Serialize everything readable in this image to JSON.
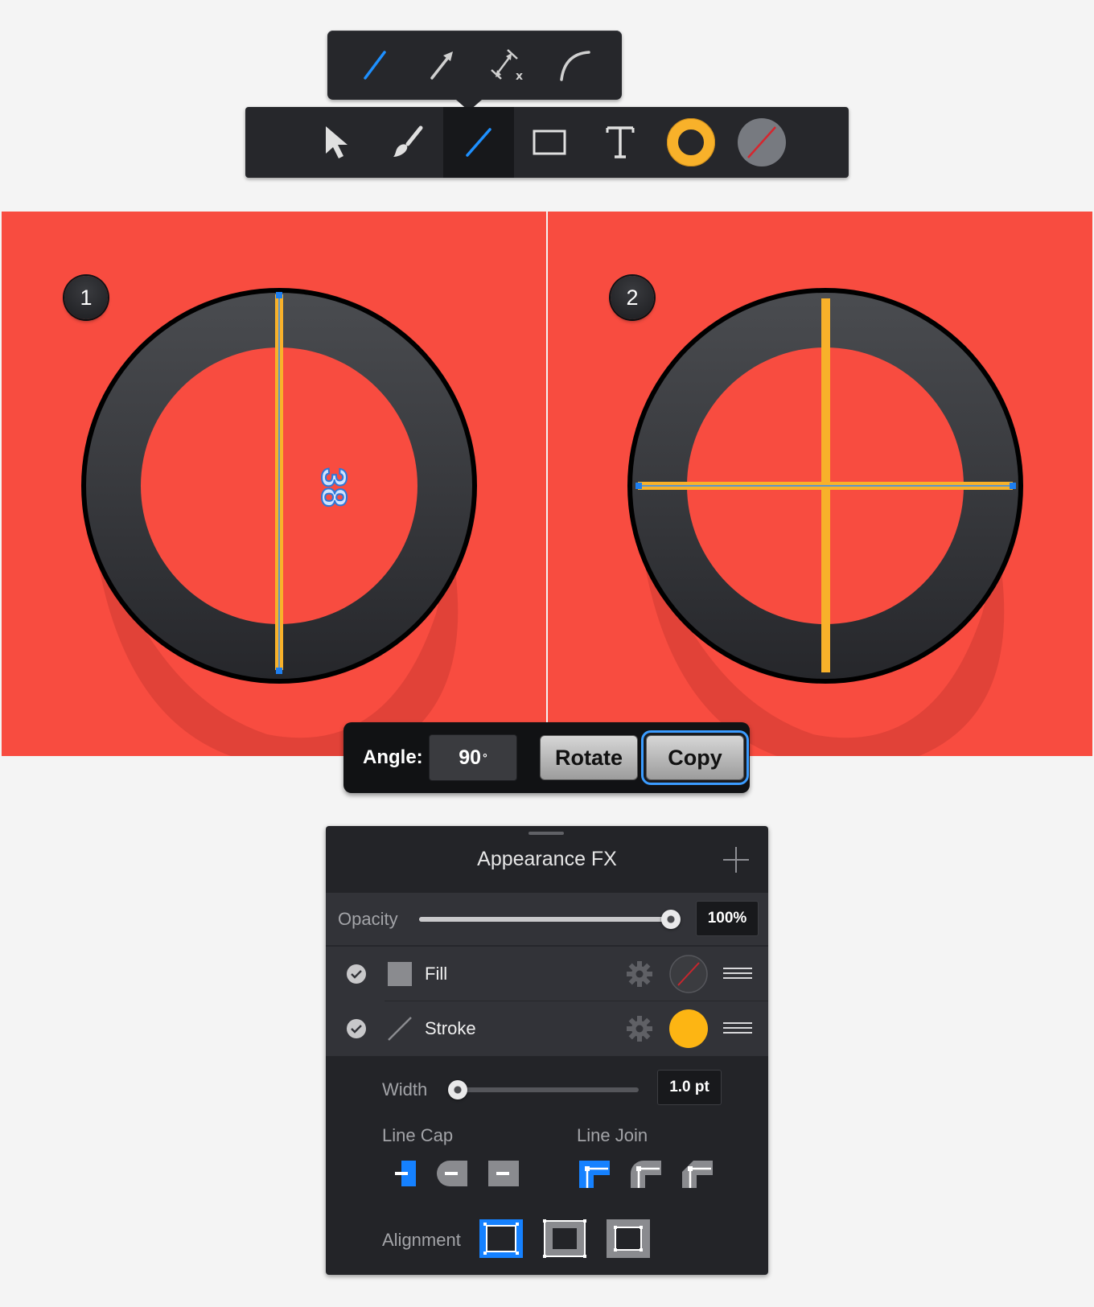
{
  "line_submenu": {
    "tools": [
      {
        "name": "line-tool",
        "color": "#1e90ff"
      },
      {
        "name": "arrow-tool",
        "color": "#cfcfcf"
      },
      {
        "name": "dimension-tool",
        "color": "#cfcfcf"
      },
      {
        "name": "arc-tool",
        "color": "#cfcfcf"
      }
    ]
  },
  "toolbar": {
    "tools": [
      "select-tool",
      "brush-tool",
      "line-tool",
      "rectangle-tool",
      "text-tool",
      "stroke-color-swatch",
      "fill-color-swatch"
    ],
    "active": "line-tool",
    "stroke_color": "#f8b12a",
    "fill_color": "none"
  },
  "canvas": {
    "background": "#f84c40",
    "steps": [
      {
        "badge": "1",
        "measure_label": "38"
      },
      {
        "badge": "2"
      }
    ]
  },
  "angle_dialog": {
    "label": "Angle:",
    "value": "90",
    "unit": "°",
    "rotate_label": "Rotate",
    "copy_label": "Copy"
  },
  "appearance": {
    "title": "Appearance FX",
    "opacity_label": "Opacity",
    "opacity_value": "100%",
    "opacity_level": 1.0,
    "rows": [
      {
        "label": "Fill",
        "enabled": true,
        "swatch": "none"
      },
      {
        "label": "Stroke",
        "enabled": true,
        "swatch": "#fdb513"
      }
    ],
    "width_label": "Width",
    "width_value": "1.0 pt",
    "width_level": 0.04,
    "line_cap_label": "Line Cap",
    "line_join_label": "Line Join",
    "alignment_label": "Alignment",
    "accent": "#1581ff"
  }
}
